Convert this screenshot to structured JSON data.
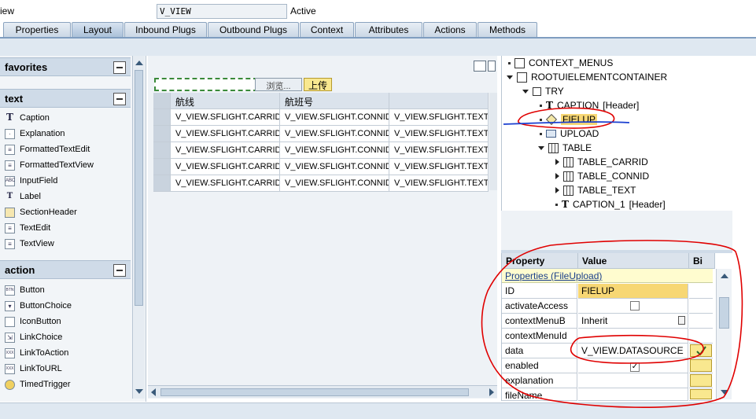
{
  "header": {
    "label": "iew",
    "view_name": "V_VIEW",
    "status": "Active"
  },
  "tabs": [
    "Properties",
    "Layout",
    "Inbound Plugs",
    "Outbound Plugs",
    "Context",
    "Attributes",
    "Actions",
    "Methods"
  ],
  "active_tab": "Layout",
  "palette": {
    "groups": [
      {
        "title": "favorites",
        "items": []
      },
      {
        "title": "text",
        "items": [
          "Caption",
          "Explanation",
          "FormattedTextEdit",
          "FormattedTextView",
          "InputField",
          "Label",
          "SectionHeader",
          "TextEdit",
          "TextView"
        ]
      },
      {
        "title": "action",
        "items": [
          "Button",
          "ButtonChoice",
          "IconButton",
          "LinkChoice",
          "LinkToAction",
          "LinkToURL",
          "TimedTrigger"
        ]
      }
    ],
    "icon_glyphs": {
      "InputField": "ABC",
      "Button": "BTN",
      "LinkToAction": "XXX",
      "LinkToURL": "XXX"
    }
  },
  "canvas": {
    "browse_label": "浏览...",
    "upload_label": "上传",
    "table": {
      "headers": [
        "航线",
        "航班号",
        ""
      ],
      "rows": [
        [
          "V_VIEW.SFLIGHT.CARRID",
          "V_VIEW.SFLIGHT.CONNID",
          "V_VIEW.SFLIGHT.TEXT"
        ],
        [
          "V_VIEW.SFLIGHT.CARRID",
          "V_VIEW.SFLIGHT.CONNID",
          "V_VIEW.SFLIGHT.TEXT"
        ],
        [
          "V_VIEW.SFLIGHT.CARRID",
          "V_VIEW.SFLIGHT.CONNID",
          "V_VIEW.SFLIGHT.TEXT"
        ],
        [
          "V_VIEW.SFLIGHT.CARRID",
          "V_VIEW.SFLIGHT.CONNID",
          "V_VIEW.SFLIGHT.TEXT"
        ],
        [
          "V_VIEW.SFLIGHT.CARRID",
          "V_VIEW.SFLIGHT.CONNID",
          "V_VIEW.SFLIGHT.TEXT"
        ]
      ]
    }
  },
  "tree": {
    "nodes": [
      {
        "label": "CONTEXT_MENUS",
        "icon": "square"
      },
      {
        "label": "ROOTUIELEMENTCONTAINER",
        "icon": "square"
      },
      {
        "label": "TRY",
        "icon": "container"
      },
      {
        "label": "CAPTION",
        "suffix": "[Header]",
        "icon": "text-T"
      },
      {
        "label": "FIELUP",
        "icon": "diamond",
        "selected": true
      },
      {
        "label": "UPLOAD",
        "icon": "upload"
      },
      {
        "label": "TABLE",
        "icon": "table"
      },
      {
        "label": "TABLE_CARRID",
        "icon": "table"
      },
      {
        "label": "TABLE_CONNID",
        "icon": "table"
      },
      {
        "label": "TABLE_TEXT",
        "icon": "table"
      },
      {
        "label": "CAPTION_1",
        "suffix": "[Header]",
        "icon": "text-T"
      }
    ]
  },
  "properties": {
    "headers": [
      "Property",
      "Value",
      "Bi"
    ],
    "group": "Properties (FileUpload)",
    "rows": [
      {
        "name": "ID",
        "value": "FIELUP"
      },
      {
        "name": "activateAccess",
        "value": "",
        "checkbox": false
      },
      {
        "name": "contextMenuB",
        "value": "Inherit",
        "dropdown": true
      },
      {
        "name": "contextMenuId",
        "value": ""
      },
      {
        "name": "data",
        "value": "V_VIEW.DATASOURCE",
        "bind_button": true
      },
      {
        "name": "enabled",
        "value": "",
        "checkbox": true,
        "bind_button": true
      },
      {
        "name": "explanation",
        "value": "",
        "bind_button": true
      },
      {
        "name": "fileName",
        "value": "",
        "bind_button": true
      }
    ]
  },
  "colors": {
    "accent": "#7f9dc0",
    "selection": "#f7d774",
    "annotation": "#e00000",
    "annotation_underline": "#1a3fd0"
  }
}
